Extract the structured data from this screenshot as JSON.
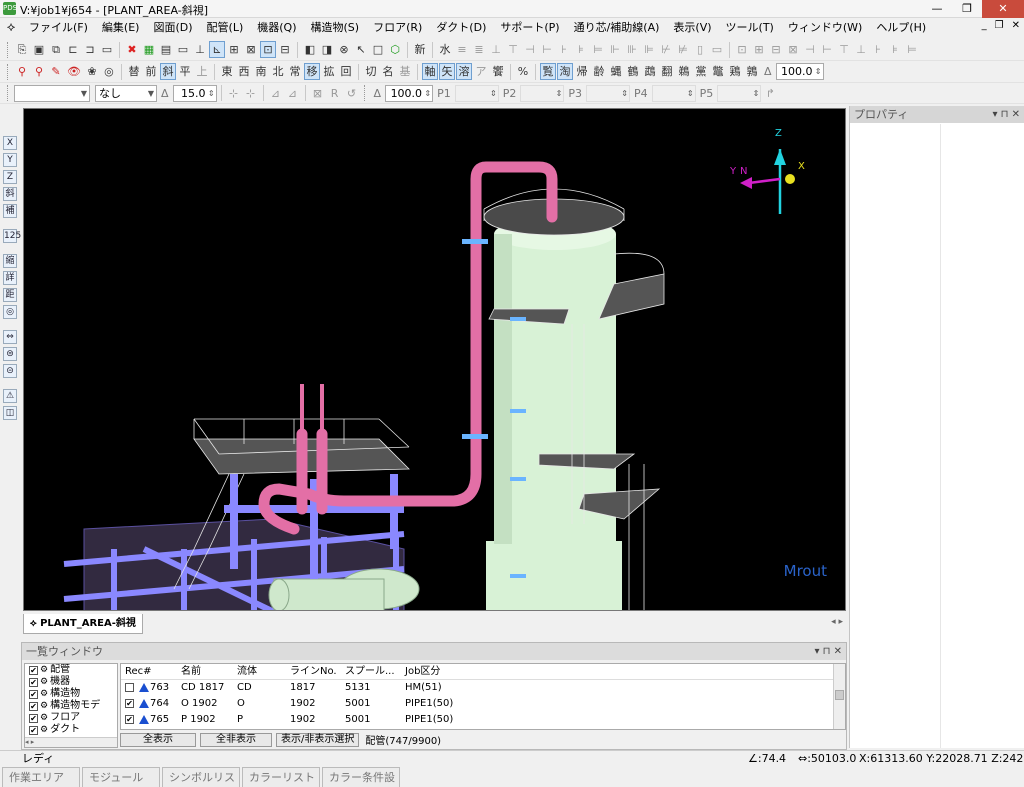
{
  "window": {
    "title": "V:¥job1¥j654 - [PLANT_AREA-斜視]",
    "app_icon": "PDS",
    "buttons": {
      "minimize": "—",
      "maximize": "❐",
      "close": "✕"
    }
  },
  "menu": [
    "ファイル(F)",
    "編集(E)",
    "図面(D)",
    "配管(L)",
    "機器(Q)",
    "構造物(S)",
    "フロア(R)",
    "ダクト(D)",
    "サポート(P)",
    "通り芯/補助線(A)",
    "表示(V)",
    "ツール(T)",
    "ウィンドウ(W)",
    "ヘルプ(H)"
  ],
  "toolbar1": {
    "items": [
      "⎘",
      "▣",
      "⧉",
      "⊏",
      "⊐",
      "▭",
      "✖",
      "▦",
      "▤",
      "▭",
      "⊥",
      "⊾",
      "⊞",
      "⊠",
      "⊡",
      "⊟",
      "◧",
      "◨",
      "⊗",
      "↖",
      "□",
      "⬡",
      "新",
      "水",
      "≡",
      "≣",
      "⊥",
      "⊤",
      "⊣",
      "⊢",
      "⊦",
      "⊧",
      "⊨",
      "⊩",
      "⊪",
      "⊫",
      "⊬",
      "⊭",
      "▯",
      "▭",
      "⊡",
      "⊞",
      "⊟",
      "⊠",
      "⊣",
      "⊢",
      "⊤",
      "⊥",
      "⊦",
      "⊧",
      "⊨"
    ],
    "new_label": "新"
  },
  "toolbar2": {
    "items": [
      "⚲",
      "⚲",
      "✎",
      "👁",
      "❀",
      "◎",
      "替",
      "前",
      "斜",
      "平",
      "上",
      "東",
      "西",
      "南",
      "北",
      "常",
      "移",
      "拡",
      "回",
      "切",
      "名",
      "基",
      "軸",
      "矢",
      "溶",
      "ア",
      "饗",
      "%",
      "覧",
      "淘",
      "帰",
      "齢",
      "蝿",
      "鶴",
      "鵡",
      "翻",
      "鵜",
      "黨",
      "鼈",
      "鶏",
      "鶉"
    ],
    "pressed": [
      8,
      16,
      22,
      23,
      24,
      28,
      29
    ],
    "dimmed": [
      10,
      21,
      25
    ],
    "delta_label": "Δ",
    "value": "100.0"
  },
  "toolbar3": {
    "combo1": "",
    "combo2": "なし",
    "delta_label": "Δ",
    "delta_value": "15.0",
    "pct_delta_label": "Δ",
    "pct_value": "100.0",
    "p_labels": [
      "P1",
      "P2",
      "P3",
      "P4",
      "P5"
    ]
  },
  "left_toolbar": [
    "X",
    "Y",
    "Z",
    "斜",
    "補",
    "125",
    "縮",
    "詳",
    "距",
    "◎",
    "⇔",
    "⊜",
    "⊝",
    "⚠",
    "◫"
  ],
  "viewport": {
    "watermark": "Mrout",
    "axis_labels": {
      "z": "Z",
      "y": "Y",
      "n": "N",
      "x": "X"
    },
    "background": "#000000"
  },
  "doc_tab": {
    "label": "PLANT_AREA-斜視",
    "nav": "◂ ▸"
  },
  "list_window": {
    "title": "一覧ウィンドウ",
    "controls": "▾ ⊓ ✕",
    "tree": [
      {
        "label": "配管",
        "checked": true
      },
      {
        "label": "機器",
        "checked": true
      },
      {
        "label": "構造物",
        "checked": true
      },
      {
        "label": "構造物モデ",
        "checked": true
      },
      {
        "label": "フロア",
        "checked": true
      },
      {
        "label": "ダクト",
        "checked": true
      }
    ],
    "columns": [
      "Rec#",
      "名前",
      "流体",
      "ラインNo.",
      "スプール...",
      "Job区分"
    ],
    "rows": [
      {
        "checked": false,
        "rec": "763",
        "name": "CD 1817",
        "fluid": "CD",
        "line": "1817",
        "spool": "5131",
        "job": "HM(51)"
      },
      {
        "checked": true,
        "rec": "764",
        "name": "O 1902",
        "fluid": "O",
        "line": "1902",
        "spool": "5001",
        "job": "PIPE1(50)"
      },
      {
        "checked": true,
        "rec": "765",
        "name": "P 1902",
        "fluid": "P",
        "line": "1902",
        "spool": "5001",
        "job": "PIPE1(50)"
      }
    ],
    "buttons": {
      "show_all": "全表示",
      "hide_all": "全非表示",
      "toggle": "表示/非表示選択"
    },
    "count": "配管(747/9900)"
  },
  "properties": {
    "title": "プロパティ",
    "controls": "▾ ⊓ ✕"
  },
  "status": {
    "ready": "レディ",
    "angle": "∠:74.4",
    "distance": "⇔:50103.0",
    "x": "X:61313.60",
    "y": "Y:22028.71",
    "z": "Z:24228.60"
  },
  "bottom_tabs": [
    "作業エリア",
    "モジュール",
    "シンボルリスト",
    "カラーリスト",
    "カラー条件設定"
  ],
  "colors": {
    "pipe": "#e36fa6",
    "vessel": "#d6f0d4",
    "structure": "#7a78f0",
    "axis_cyan": "#22d3e0",
    "axis_magenta": "#d020c8",
    "axis_yellow": "#e8e020"
  }
}
